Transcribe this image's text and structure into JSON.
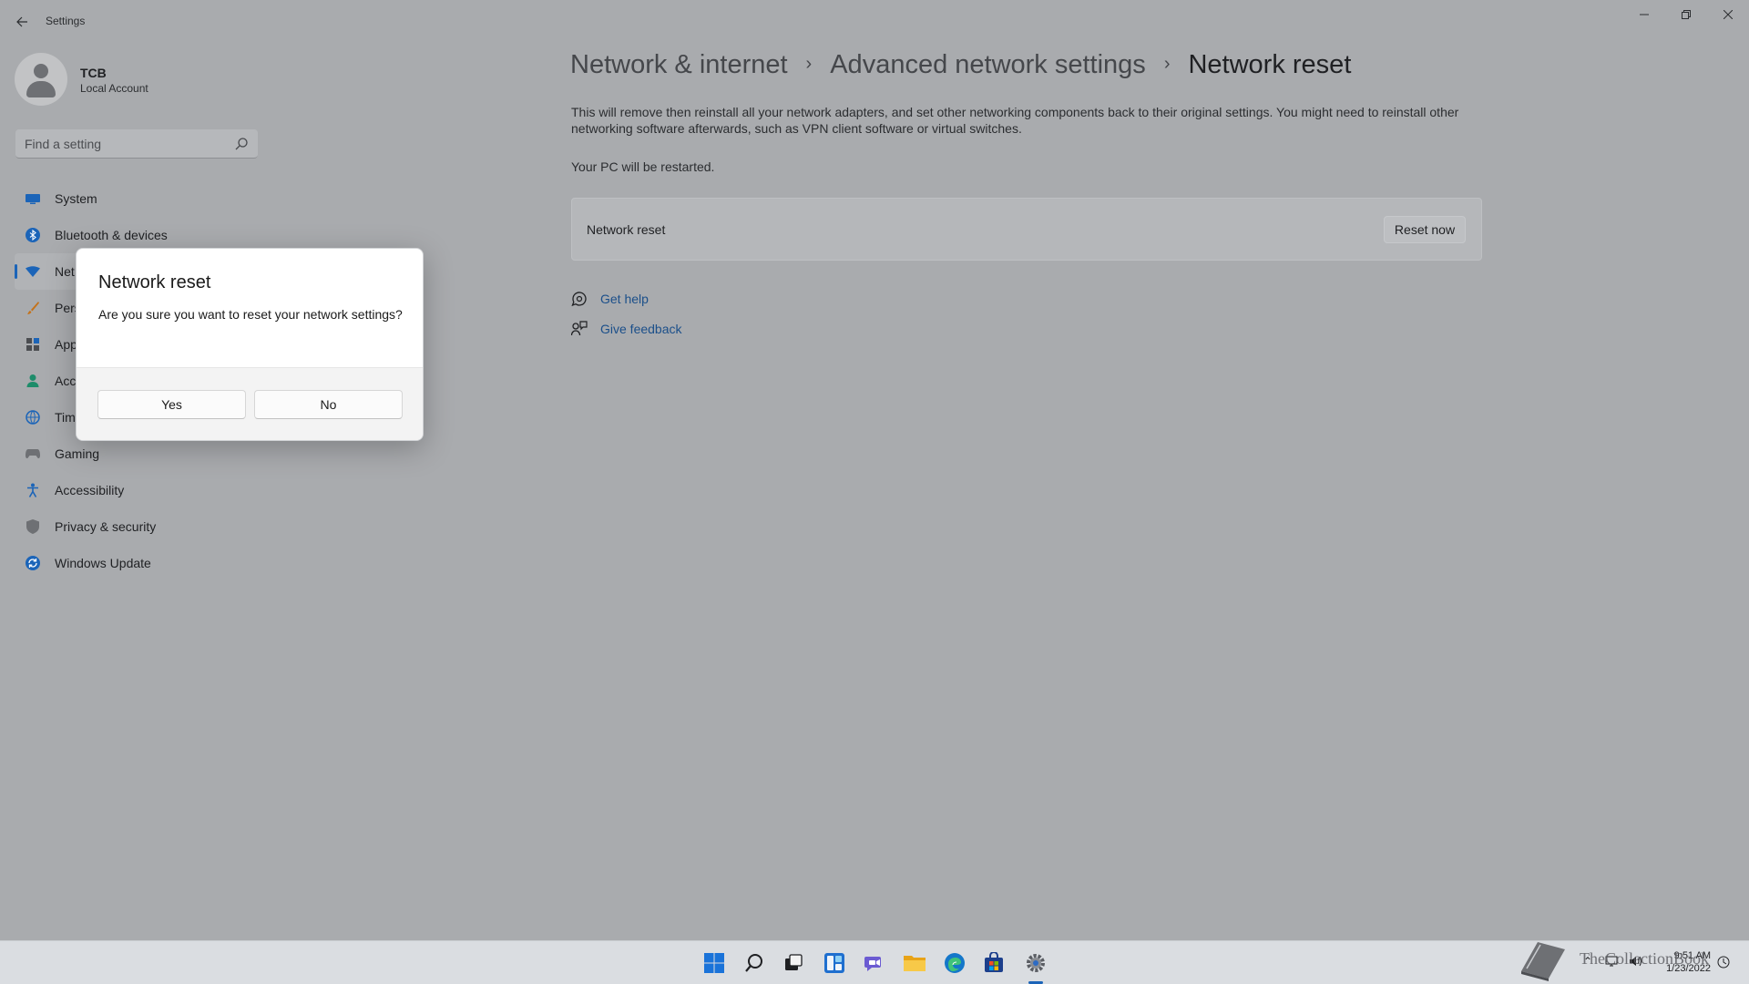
{
  "window": {
    "title": "Settings"
  },
  "profile": {
    "name": "TCB",
    "account_type": "Local Account"
  },
  "search": {
    "placeholder": "Find a setting"
  },
  "sidebar": {
    "items": [
      {
        "label": "System",
        "icon": "monitor-icon"
      },
      {
        "label": "Bluetooth & devices",
        "icon": "bluetooth-icon"
      },
      {
        "label": "Net",
        "icon": "wifi-icon",
        "active": true
      },
      {
        "label": "Pers",
        "icon": "brush-icon"
      },
      {
        "label": "App",
        "icon": "apps-icon"
      },
      {
        "label": "Acc",
        "icon": "person-icon"
      },
      {
        "label": "Tim",
        "icon": "globe-clock-icon"
      },
      {
        "label": "Gaming",
        "icon": "gamepad-icon"
      },
      {
        "label": "Accessibility",
        "icon": "accessibility-icon"
      },
      {
        "label": "Privacy & security",
        "icon": "shield-icon"
      },
      {
        "label": "Windows Update",
        "icon": "update-icon"
      }
    ]
  },
  "breadcrumb": {
    "items": [
      "Network & internet",
      "Advanced network settings",
      "Network reset"
    ],
    "separator": "›"
  },
  "main": {
    "description": "This will remove then reinstall all your network adapters, and set other networking components back to their original settings. You might need to reinstall other networking software afterwards, such as VPN client software or virtual switches.",
    "restart_note": "Your PC will be restarted.",
    "card": {
      "label": "Network reset",
      "button": "Reset now"
    },
    "links": {
      "help": "Get help",
      "feedback": "Give feedback"
    }
  },
  "dialog": {
    "title": "Network reset",
    "message": "Are you sure you want to reset your network settings?",
    "yes_label": "Yes",
    "no_label": "No"
  },
  "taskbar": {
    "apps": [
      "start-icon",
      "search-icon",
      "task-view-icon",
      "widgets-icon",
      "chat-icon",
      "file-explorer-icon",
      "edge-icon",
      "store-icon",
      "settings-icon"
    ],
    "active_app": "settings-icon",
    "time": "9:51 AM",
    "date": "1/23/2022"
  },
  "watermark": {
    "text": "TheCollectionBook"
  },
  "colors": {
    "accent": "#1b64b8",
    "link": "#1b4f8a",
    "dim_background": "#a9abae"
  }
}
